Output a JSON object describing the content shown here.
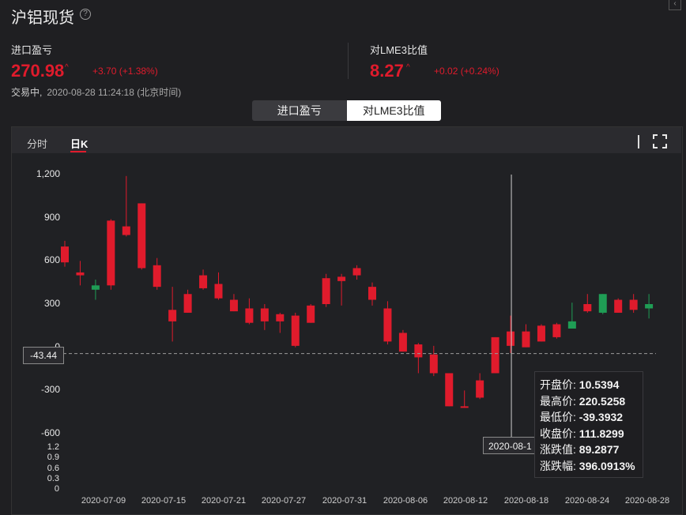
{
  "header": {
    "title": "沪铝现货",
    "help_icon": "?",
    "corner_icon": "‹"
  },
  "quote_import": {
    "label": "进口盈亏",
    "value": "270.98",
    "change": "+3.70 (+1.38%)"
  },
  "quote_lme": {
    "label": "对LME3比值",
    "value": "8.27",
    "change": "+0.02 (+0.24%)"
  },
  "status": {
    "state": "交易中,",
    "time": "2020-08-28 11:24:18 (北京时间)"
  },
  "toggle": {
    "option_a": "进口盈亏",
    "option_b": "对LME3比值",
    "selected": "对LME3比值"
  },
  "tabs": {
    "intraday": "分时",
    "daily": "日K",
    "active": "日K"
  },
  "colors": {
    "up": "#e01b2c",
    "down": "#1f9d55",
    "background": "#1f1f22"
  },
  "crosshair": {
    "value_label": "-43.44",
    "date_label": "2020-08-1"
  },
  "tooltip": {
    "open_key": "开盘价:",
    "open_val": "10.5394",
    "high_key": "最高价:",
    "high_val": "220.5258",
    "low_key": "最低价:",
    "low_val": "-39.3932",
    "close_key": "收盘价:",
    "close_val": "111.8299",
    "chg_key": "涨跌值:",
    "chg_val": "89.2877",
    "pct_key": "涨跌幅:",
    "pct_val": "396.0913%"
  },
  "chart_data": {
    "type": "candlestick",
    "y_ticks": [
      "1,200",
      "900",
      "600",
      "300",
      "0",
      "-300",
      "-600"
    ],
    "y_range": [
      -600,
      1200
    ],
    "volume_ticks": [
      "1.2",
      "0.9",
      "0.6",
      "0.3",
      "0"
    ],
    "x_labels": [
      "2020-07-09",
      "2020-07-15",
      "2020-07-21",
      "2020-07-27",
      "2020-07-31",
      "2020-08-06",
      "2020-08-12",
      "2020-08-18",
      "2020-08-24",
      "2020-08-28"
    ],
    "candles": [
      {
        "o": 590,
        "h": 740,
        "l": 560,
        "c": 700
      },
      {
        "o": 500,
        "h": 600,
        "l": 430,
        "c": 520
      },
      {
        "o": 430,
        "h": 470,
        "l": 330,
        "c": 400
      },
      {
        "o": 430,
        "h": 890,
        "l": 400,
        "c": 880
      },
      {
        "o": 780,
        "h": 1190,
        "l": 770,
        "c": 840
      },
      {
        "o": 550,
        "h": 1000,
        "l": 540,
        "c": 1000
      },
      {
        "o": 420,
        "h": 620,
        "l": 400,
        "c": 570
      },
      {
        "o": 180,
        "h": 420,
        "l": 40,
        "c": 260
      },
      {
        "o": 240,
        "h": 400,
        "l": 240,
        "c": 370
      },
      {
        "o": 410,
        "h": 540,
        "l": 400,
        "c": 500
      },
      {
        "o": 340,
        "h": 520,
        "l": 330,
        "c": 440
      },
      {
        "o": 250,
        "h": 370,
        "l": 250,
        "c": 330
      },
      {
        "o": 170,
        "h": 340,
        "l": 160,
        "c": 270
      },
      {
        "o": 180,
        "h": 300,
        "l": 120,
        "c": 270
      },
      {
        "o": 180,
        "h": 240,
        "l": 100,
        "c": 230
      },
      {
        "o": 10,
        "h": 240,
        "l": 0,
        "c": 220
      },
      {
        "o": 170,
        "h": 300,
        "l": 170,
        "c": 290
      },
      {
        "o": 300,
        "h": 510,
        "l": 280,
        "c": 480
      },
      {
        "o": 460,
        "h": 510,
        "l": 290,
        "c": 490
      },
      {
        "o": 500,
        "h": 570,
        "l": 470,
        "c": 550
      },
      {
        "o": 330,
        "h": 450,
        "l": 290,
        "c": 420
      },
      {
        "o": 40,
        "h": 320,
        "l": 20,
        "c": 270
      },
      {
        "o": -30,
        "h": 120,
        "l": -30,
        "c": 100
      },
      {
        "o": -70,
        "h": 30,
        "l": -180,
        "c": 20
      },
      {
        "o": -180,
        "h": 10,
        "l": -200,
        "c": -50
      },
      {
        "o": -410,
        "h": -180,
        "l": -410,
        "c": -180
      },
      {
        "o": -420,
        "h": -300,
        "l": -420,
        "c": -410
      },
      {
        "o": -350,
        "h": -180,
        "l": -360,
        "c": -230
      },
      {
        "o": -180,
        "h": 70,
        "l": -180,
        "c": 70
      },
      {
        "o": 10,
        "h": 220,
        "l": -40,
        "c": 110
      },
      {
        "o": 0,
        "h": 160,
        "l": 0,
        "c": 110
      },
      {
        "o": 40,
        "h": 160,
        "l": 40,
        "c": 150
      },
      {
        "o": 70,
        "h": 170,
        "l": 60,
        "c": 160
      },
      {
        "o": 180,
        "h": 310,
        "l": 130,
        "c": 130
      },
      {
        "o": 250,
        "h": 370,
        "l": 240,
        "c": 300
      },
      {
        "o": 370,
        "h": 370,
        "l": 230,
        "c": 240
      },
      {
        "o": 240,
        "h": 340,
        "l": 240,
        "c": 330
      },
      {
        "o": 260,
        "h": 370,
        "l": 240,
        "c": 330
      },
      {
        "o": 300,
        "h": 370,
        "l": 200,
        "c": 270
      }
    ]
  }
}
